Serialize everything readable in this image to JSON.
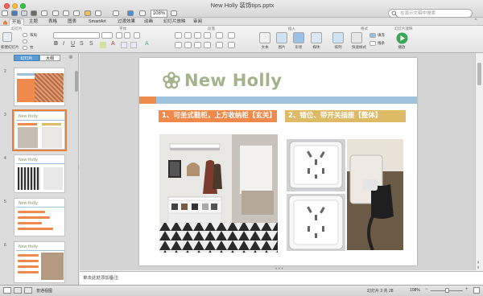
{
  "window": {
    "title": "New Holly 装饰tips.pptx",
    "zoom": "108%"
  },
  "search": {
    "placeholder": "在演示文稿中搜索"
  },
  "tabs": [
    "开始",
    "主题",
    "表格",
    "图表",
    "SmartArt",
    "过渡效果",
    "动画",
    "幻灯片放映",
    "审阅"
  ],
  "ribbon": {
    "groups": {
      "slides": "幻灯片",
      "font": "字体",
      "paragraph": "段落",
      "insert": "插入",
      "format": "格式",
      "slideshow": "幻灯片放映"
    },
    "new_slide": "新建幻灯片",
    "layout": "布局",
    "section": "节",
    "text": "文本",
    "picture": "图片",
    "shape": "形状",
    "media": "媒体",
    "arrange": "排列",
    "quick_styles": "快速样式",
    "fill": "填充",
    "line": "线条",
    "play": "播放"
  },
  "sidebar": {
    "tab_slides": "幻灯片",
    "tab_outline": "大纲",
    "thumbs": [
      {
        "num": "2",
        "title": ""
      },
      {
        "num": "3",
        "title": "New Holly"
      },
      {
        "num": "4",
        "title": "New Holly"
      },
      {
        "num": "5",
        "title": "New Holly"
      },
      {
        "num": "6",
        "title": "New Holly"
      }
    ]
  },
  "slide": {
    "title": "New Holly",
    "caption1": "1、可坐式鞋柜，上方收纳柜【玄关】",
    "caption2": "2、错位、带开关插座【整体】",
    "colors": {
      "brand_green": "#a4b38c",
      "orange": "#ef8a4c",
      "blue": "#9fc2dd",
      "gold": "#ddbb66"
    }
  },
  "notes": {
    "placeholder": "单击此处添加备注"
  },
  "status": {
    "view": "普通视图",
    "slide_count": "幻灯片 3 共 28",
    "zoom": "108%"
  }
}
